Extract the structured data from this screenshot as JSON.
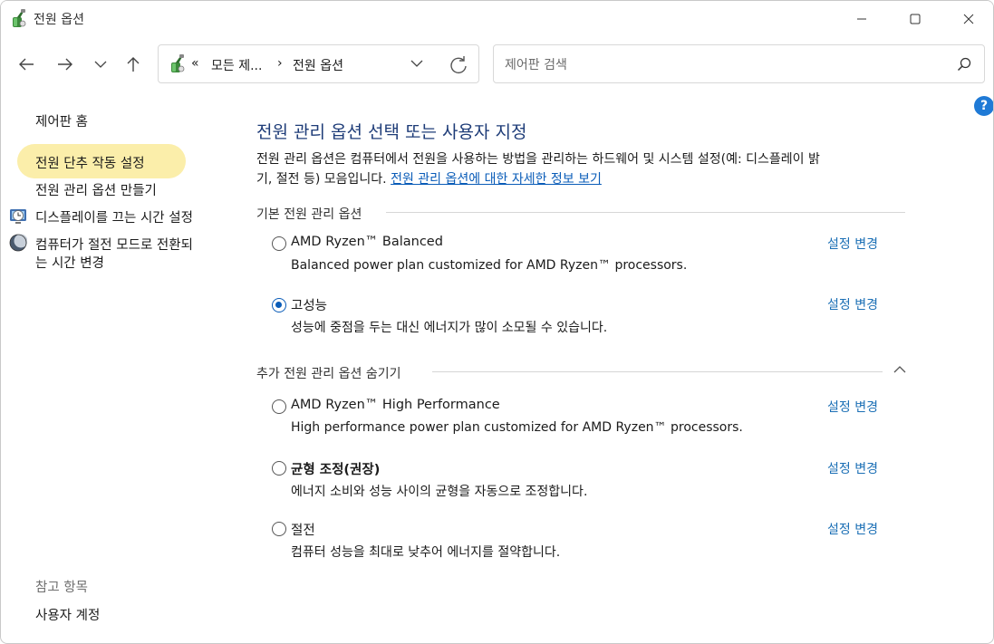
{
  "window": {
    "title": "전원 옵션"
  },
  "nav": {
    "breadcrumb_prefix": "«",
    "breadcrumb_1": "모든 제...",
    "breadcrumb_sep": "›",
    "breadcrumb_2": "전원 옵션",
    "search_placeholder": "제어판 검색",
    "help": "?"
  },
  "sidebar": {
    "home": "제어판 홈",
    "items": [
      {
        "label": "전원 단추 작동 설정",
        "icon": "none",
        "highlighted": true
      },
      {
        "label": "전원 관리 옵션 만들기",
        "icon": "none"
      },
      {
        "label": "디스플레이를 끄는 시간 설정",
        "icon": "monitor-clock-icon"
      },
      {
        "label_line1": "컴퓨터가 절전 모드로 전환되",
        "label_line2": "는 시간 변경",
        "icon": "moon-icon"
      }
    ],
    "see_also": "참고 항목",
    "user_accounts": "사용자 계정"
  },
  "main": {
    "heading": "전원 관리 옵션 선택 또는 사용자 지정",
    "description_line1": "전원 관리 옵션은 컴퓨터에서 전원을 사용하는 방법을 관리하는 하드웨어 및 시스템 설정(예: 디스플레이 밝",
    "description_line2": "기, 절전 등) 모음입니다.",
    "description_link": "전원 관리 옵션에 대한 자세한 정보 보기",
    "basic_section": "기본 전원 관리 옵션",
    "extra_section": "추가 전원 관리 옵션 숨기기",
    "change_label": "설정 변경",
    "plans": [
      {
        "name": "AMD Ryzen™ Balanced",
        "desc": "Balanced power plan customized for AMD Ryzen™ processors.",
        "selected": false,
        "bold": false
      },
      {
        "name": "고성능",
        "desc": "성능에 중점을 두는 대신 에너지가 많이 소모될 수 있습니다.",
        "selected": true,
        "bold": false
      },
      {
        "name": "AMD Ryzen™ High Performance",
        "desc": "High performance power plan customized for AMD Ryzen™ processors.",
        "selected": false,
        "bold": false
      },
      {
        "name": "균형 조정(권장)",
        "desc": "에너지 소비와 성능 사이의 균형을 자동으로 조정합니다.",
        "selected": false,
        "bold": true
      },
      {
        "name": "절전",
        "desc": "컴퓨터 성능을 최대로 낮추어 에너지를 절약합니다.",
        "selected": false,
        "bold": false
      }
    ]
  },
  "colors": {
    "accent": "#0a5cb8",
    "heading": "#1e3c78",
    "link": "#1b6fb5",
    "highlight": "#fbeeaa"
  }
}
